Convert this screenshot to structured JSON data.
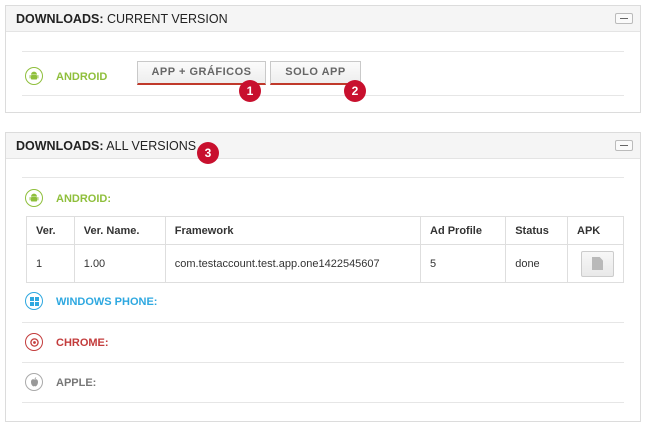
{
  "current": {
    "title_bold": "DOWNLOADS:",
    "title_rest": " CURRENT VERSION",
    "platform": "ANDROID",
    "buttons": [
      {
        "label": "APP + GRÁFICOS",
        "badge": "1"
      },
      {
        "label": "SOLO APP",
        "badge": "2"
      }
    ]
  },
  "all": {
    "title_bold": "DOWNLOADS:",
    "title_rest": " ALL VERSIONS",
    "badge": "3",
    "android_label": "ANDROID:",
    "table": {
      "headers": [
        "Ver.",
        "Ver. Name.",
        "Framework",
        "Ad Profile",
        "Status",
        "APK"
      ],
      "rows": [
        [
          "1",
          "1.00",
          "com.testaccount.test.app.one1422545607",
          "5",
          "done"
        ]
      ]
    },
    "windows_label": "WINDOWS PHONE:",
    "chrome_label": "CHROME:",
    "apple_label": "APPLE:"
  },
  "colors": {
    "android": "#8fbf3c",
    "windows": "#2ea8e0",
    "chrome": "#c33c3c",
    "apple": "#777777",
    "badge": "#c8102e"
  },
  "icons": {
    "android": "android-icon",
    "windows": "windows-icon",
    "chrome": "chrome-icon",
    "apple": "apple-icon",
    "apk": "file-icon",
    "collapse": "minus-icon"
  }
}
